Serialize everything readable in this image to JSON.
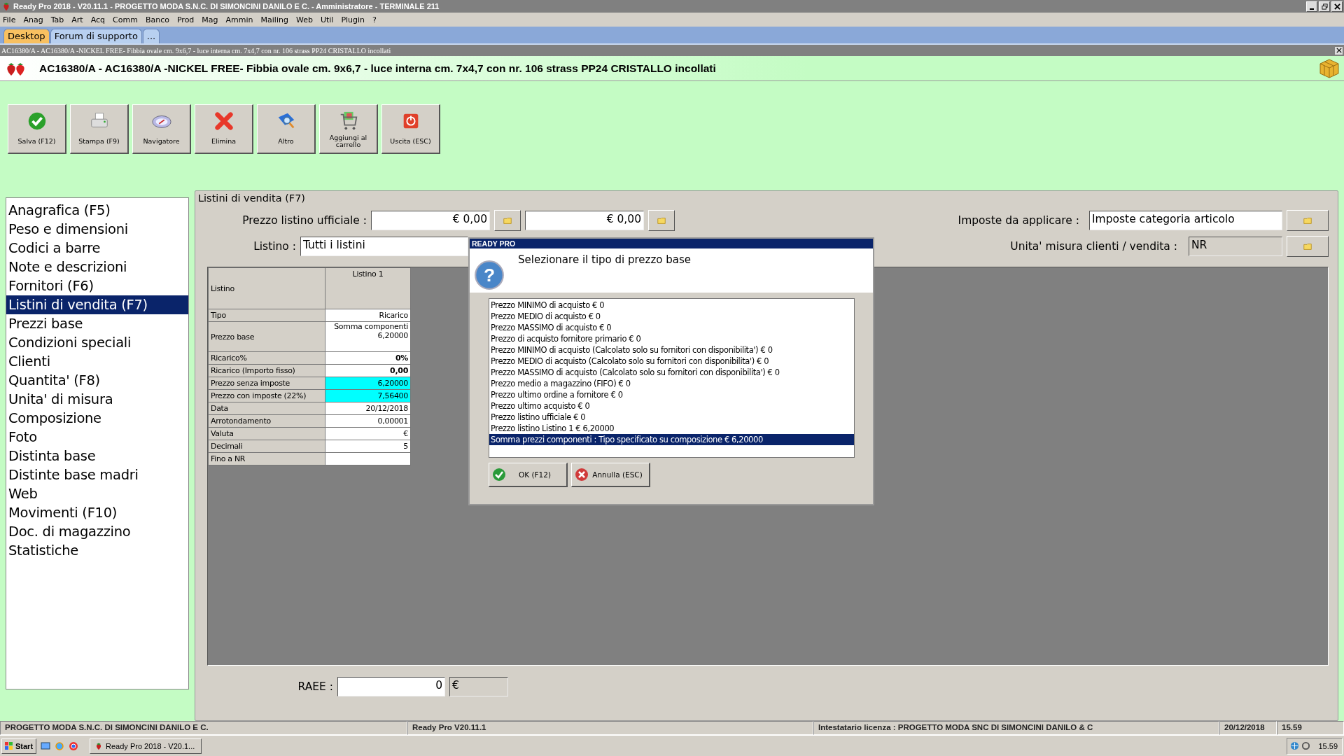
{
  "window": {
    "title": "Ready Pro 2018 - V20.11.1 - PROGETTO MODA S.N.C. DI SIMONCINI DANILO E C. - Amministratore - TERMINALE 211"
  },
  "menu": [
    "File",
    "Anag",
    "Tab",
    "Art",
    "Acq",
    "Comm",
    "Banco",
    "Prod",
    "Mag",
    "Ammin",
    "Mailing",
    "Web",
    "Util",
    "Plugin",
    "?"
  ],
  "tabs": [
    {
      "label": "Desktop",
      "selected": true
    },
    {
      "label": "Forum di supporto",
      "selected": false
    },
    {
      "label": "...",
      "selected": false
    }
  ],
  "document": {
    "caption": "AC16380/A - AC16380/A -NICKEL FREE- Fibbia ovale cm. 9x6,7 - luce interna cm. 7x4,7 con nr. 106 strass PP24 CRISTALLO incollati",
    "title": "AC16380/A - AC16380/A -NICKEL FREE- Fibbia ovale cm. 9x6,7 - luce interna cm. 7x4,7 con nr. 106 strass PP24 CRISTALLO incollati"
  },
  "toolbar": [
    {
      "label": "Salva (F12)",
      "kind": "save"
    },
    {
      "label": "Stampa (F9)",
      "kind": "print"
    },
    {
      "label": "Navigatore",
      "kind": "navigator"
    },
    {
      "label": "Elimina",
      "kind": "delete"
    },
    {
      "label": "Altro",
      "kind": "other"
    },
    {
      "label": "Aggiungi al carrello",
      "kind": "cart"
    },
    {
      "label": "Uscita (ESC)",
      "kind": "exit"
    }
  ],
  "sidebar": {
    "items": [
      {
        "label": "Anagrafica (F5)",
        "selected": false
      },
      {
        "label": "Peso e dimensioni",
        "selected": false
      },
      {
        "label": "Codici a barre",
        "selected": false
      },
      {
        "label": "Note e descrizioni",
        "selected": false
      },
      {
        "label": "Fornitori (F6)",
        "selected": false
      },
      {
        "label": "Listini di vendita (F7)",
        "selected": true
      },
      {
        "label": "Prezzi base",
        "selected": false
      },
      {
        "label": "Condizioni speciali",
        "selected": false
      },
      {
        "label": "Clienti",
        "selected": false
      },
      {
        "label": "Quantita' (F8)",
        "selected": false
      },
      {
        "label": "Unita' di misura",
        "selected": false
      },
      {
        "label": "Composizione",
        "selected": false
      },
      {
        "label": "Foto",
        "selected": false
      },
      {
        "label": "Distinta base",
        "selected": false
      },
      {
        "label": "Distinte base madri",
        "selected": false
      },
      {
        "label": "Web",
        "selected": false
      },
      {
        "label": "Movimenti (F10)",
        "selected": false
      },
      {
        "label": "Doc. di magazzino",
        "selected": false
      },
      {
        "label": "Statistiche",
        "selected": false
      }
    ]
  },
  "panel": {
    "title": "Listini di vendita (F7)",
    "prezzo_listino_ufficiale": {
      "label": "Prezzo listino ufficiale :",
      "values": [
        "€ 0,00",
        "€ 0,00"
      ]
    },
    "listino": {
      "label": "Listino :",
      "value": "Tutti i listini"
    },
    "imposte": {
      "label": "Imposte da applicare :",
      "value": "Imposte categoria articolo",
      "disabled": false
    },
    "unita_misura": {
      "label": "Unita' misura clienti / vendita :",
      "value": "NR",
      "disabled": true
    },
    "table": {
      "columns": [
        "Listino",
        "Listino 1"
      ],
      "rows": [
        {
          "label": "Tipo",
          "value": "Ricarico",
          "bold": false,
          "highlighted": false
        },
        {
          "label": "Prezzo base",
          "value": "Somma componenti\n6,20000",
          "bold": false,
          "highlighted": false
        },
        {
          "label": "Ricarico%",
          "value": "0%",
          "bold": true,
          "highlighted": false
        },
        {
          "label": "Ricarico (Importo fisso)",
          "value": "0,00",
          "bold": true,
          "highlighted": false
        },
        {
          "label": "Prezzo senza imposte",
          "value": "6,20000",
          "bold": false,
          "highlighted": true
        },
        {
          "label": "Prezzo con imposte (22%)",
          "value": "7,56400",
          "bold": false,
          "highlighted": true
        },
        {
          "label": "Data",
          "value": "20/12/2018",
          "bold": false,
          "highlighted": false
        },
        {
          "label": "Arrotondamento",
          "value": "0,00001",
          "bold": false,
          "highlighted": false
        },
        {
          "label": "Valuta",
          "value": "€",
          "bold": false,
          "highlighted": false
        },
        {
          "label": "Decimali",
          "value": "5",
          "bold": false,
          "highlighted": false
        },
        {
          "label": "Fino a NR",
          "value": "",
          "highlighted": false
        }
      ]
    },
    "raee": {
      "label": "RAEE :",
      "value": "0",
      "currency": "€"
    }
  },
  "dialog": {
    "title": "READY PRO",
    "icon_glyph": "?",
    "message": "Selezionare il tipo di prezzo base",
    "options": [
      {
        "label": "Prezzo MINIMO di acquisto € 0",
        "selected": false
      },
      {
        "label": "Prezzo MEDIO di acquisto € 0",
        "selected": false
      },
      {
        "label": "Prezzo MASSIMO di acquisto € 0",
        "selected": false
      },
      {
        "label": "Prezzo di acquisto fornitore primario € 0",
        "selected": false
      },
      {
        "label": "Prezzo MINIMO di acquisto (Calcolato solo su fornitori con disponibilita') € 0",
        "selected": false
      },
      {
        "label": "Prezzo MEDIO di acquisto (Calcolato solo su fornitori con disponibilita') € 0",
        "selected": false
      },
      {
        "label": "Prezzo MASSIMO di acquisto (Calcolato solo su fornitori con disponibilita') € 0",
        "selected": false
      },
      {
        "label": "Prezzo medio a magazzino (FIFO) € 0",
        "selected": false
      },
      {
        "label": "Prezzo ultimo ordine a fornitore € 0",
        "selected": false
      },
      {
        "label": "Prezzo ultimo acquisto € 0",
        "selected": false
      },
      {
        "label": "Prezzo listino ufficiale € 0",
        "selected": false
      },
      {
        "label": "Prezzo listino Listino 1 € 6,20000",
        "selected": false
      },
      {
        "label": "Somma prezzi componenti : Tipo specificato su composizione € 6,20000",
        "selected": true
      }
    ],
    "buttons": [
      {
        "label": "OK (F12)",
        "kind": "ok"
      },
      {
        "label": "Annulla (ESC)",
        "kind": "cancel"
      }
    ]
  },
  "status_bar": [
    "PROGETTO MODA S.N.C. DI SIMONCINI DANILO E C.",
    "Ready Pro V20.11.1",
    "Intestatario licenza : PROGETTO MODA SNC DI SIMONCINI DANILO & C",
    "20/12/2018",
    "15.59"
  ],
  "taskbar": {
    "start": "Start",
    "task": "Ready Pro 2018 - V20.1...",
    "clock": "15.59"
  }
}
